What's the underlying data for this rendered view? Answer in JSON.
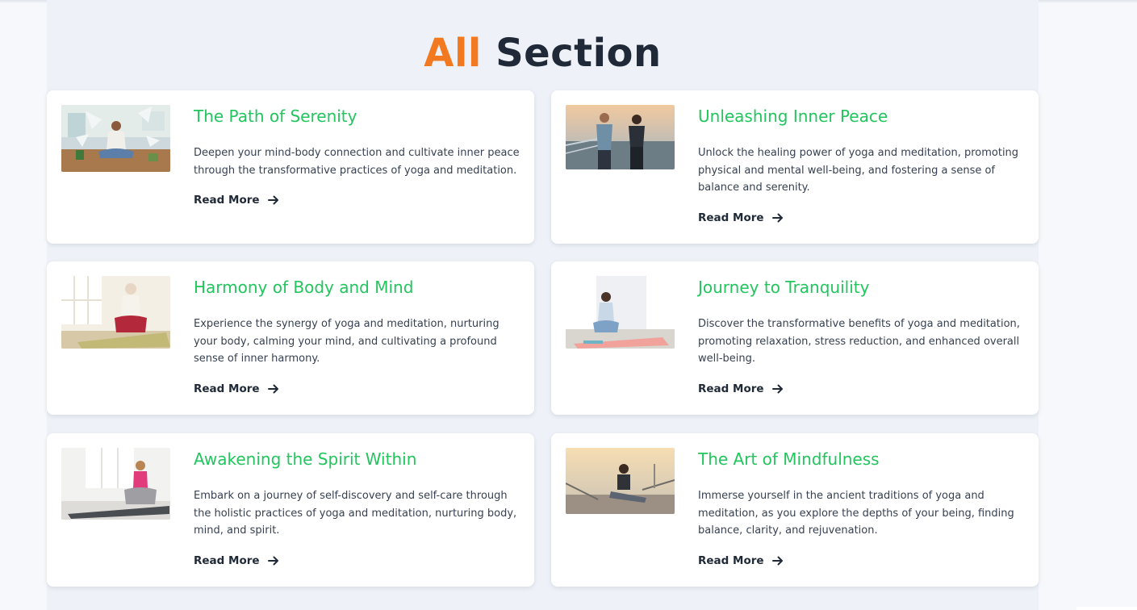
{
  "section": {
    "title_accent": "All",
    "title_rest": "Section",
    "accent_color": "#f37921",
    "title_color": "#1f2937",
    "card_title_color": "#22c55e"
  },
  "cards": [
    {
      "title": "The Path of Serenity",
      "description": "Deepen your mind-body connection and cultivate inner peace through the transformative practices of yoga and meditation.",
      "read_more": "Read More",
      "image_icon": "meditation-room-photo"
    },
    {
      "title": "Unleashing Inner Peace",
      "description": "Unlock the healing power of yoga and meditation, promoting physical and mental well-being, and fostering a sense of balance and serenity.",
      "read_more": "Read More",
      "image_icon": "couple-stretching-photo"
    },
    {
      "title": "Harmony of Body and Mind",
      "description": "Experience the synergy of yoga and meditation, nurturing your body, calming your mind, and cultivating a profound sense of inner harmony.",
      "read_more": "Read More",
      "image_icon": "woman-praying-pose-photo"
    },
    {
      "title": "Journey to Tranquility",
      "description": "Discover the transformative benefits of yoga and meditation, promoting relaxation, stress reduction, and enhanced overall well-being.",
      "read_more": "Read More",
      "image_icon": "woman-lotus-mat-photo"
    },
    {
      "title": "Awakening the Spirit Within",
      "description": "Embark on a journey of self-discovery and self-care through the holistic practices of yoga and meditation, nurturing body, mind, and spirit.",
      "read_more": "Read More",
      "image_icon": "woman-lotus-studio-photo"
    },
    {
      "title": "The Art of Mindfulness",
      "description": "Immerse yourself in the ancient traditions of yoga and meditation, as you explore the depths of your being, finding balance, clarity, and rejuvenation.",
      "read_more": "Read More",
      "image_icon": "woman-bridge-stretch-photo"
    }
  ]
}
